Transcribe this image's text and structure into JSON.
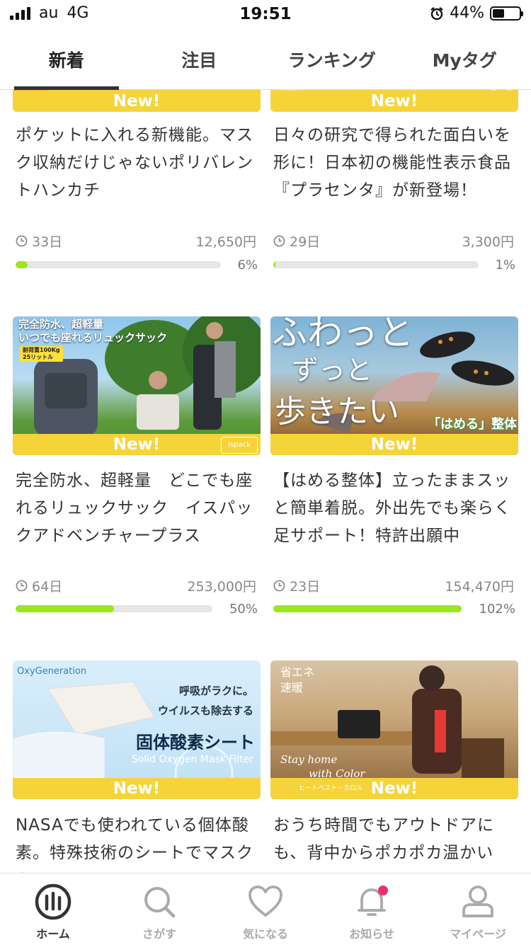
{
  "status_bar": {
    "carrier": "au",
    "network": "4G",
    "time": "19:51",
    "battery": "44%"
  },
  "tabs": [
    "新着",
    "注目",
    "ランキング",
    "Myタグ"
  ],
  "new_label": "New!",
  "cards": [
    {
      "title": "ポケットに入れる新機能。マスク収納だけじゃないポリバレントハンカチ",
      "days": "33日",
      "price": "12,650円",
      "percent": "6%",
      "progress": 6
    },
    {
      "title": "日々の研究で得られた面白いを形に！日本初の機能性表示食品『プラセンタ』が新登場！",
      "days": "29日",
      "price": "3,300円",
      "percent": "1%",
      "progress": 1
    },
    {
      "title": "完全防水、超軽量　どこでも座れるリュックサック　イスパックアドベンチャープラス",
      "days": "64日",
      "price": "253,000円",
      "percent": "50%",
      "progress": 50,
      "image_text": {
        "headline1": "完全防水、超軽量",
        "headline2": "いつでも座れるリュックサック",
        "badge1": "耐荷重100Kg",
        "badge2": "25リットル",
        "brand": "ispack"
      }
    },
    {
      "title": "【はめる整体】立ったままスッと簡単着脱。外出先でも楽らく足サポート！特許出願中",
      "days": "23日",
      "price": "154,470円",
      "percent": "102%",
      "progress": 102,
      "image_text": {
        "line1": "ふわっと",
        "line2": "ずっと",
        "line3": "歩きたい",
        "tag": "「はめる」整体"
      }
    },
    {
      "title": "NASAでも使われている個体酸素。特殊技術のシートでマスクを…",
      "days": "",
      "price": "",
      "percent": "",
      "progress": 0,
      "image_text": {
        "brand": "OxyGeneration",
        "line1": "呼吸がラクに。",
        "line2": "ウイルスも除去する",
        "line3": "固体酸素シート",
        "line4": "Solid Oxygen Mask Filter"
      }
    },
    {
      "title": "おうち時間でもアウトドアにも、背中からポカポカ温かいヒ…",
      "days": "",
      "price": "",
      "percent": "",
      "progress": 0,
      "image_text": {
        "line1": "省エネ",
        "line2": "速暖",
        "line3": "Stay home",
        "line4": "with Color",
        "line5": "ヒートベスト・カロル"
      }
    }
  ],
  "bottom_nav": [
    "ホーム",
    "さがす",
    "気になる",
    "お知らせ",
    "マイページ"
  ],
  "colors": {
    "new_bar": "#f5d43a",
    "progress": "#9ce61c",
    "notification_dot": "#e8326e"
  }
}
